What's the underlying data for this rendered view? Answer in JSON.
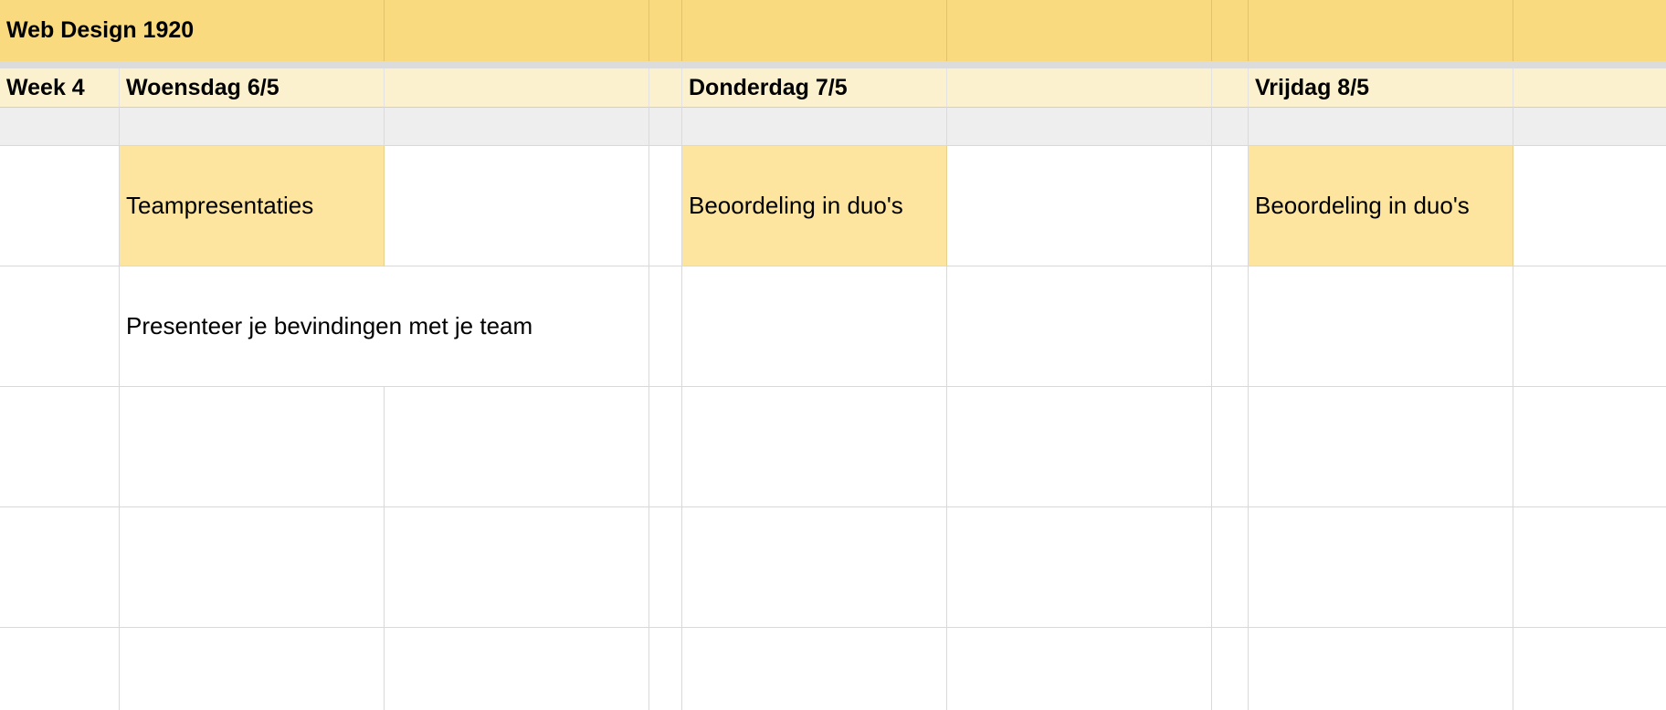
{
  "sheet": {
    "title": "Web Design 1920",
    "week_label": "Week 4",
    "days": {
      "wednesday": "Woensdag 6/5",
      "thursday": "Donderdag 7/5",
      "friday": "Vrijdag 8/5"
    },
    "activities": {
      "wednesday": "Teampresentaties",
      "thursday": "Beoordeling in duo's",
      "friday": "Beoordeling in duo's"
    },
    "descriptions": {
      "wednesday": "Presenteer je bevindingen met je team"
    }
  },
  "colors": {
    "title_row": "#f9da7e",
    "day_row": "#fcf1ce",
    "grey_row": "#eeeeee",
    "activity_highlight": "#fde59f",
    "gridline": "#d9d9d9"
  }
}
